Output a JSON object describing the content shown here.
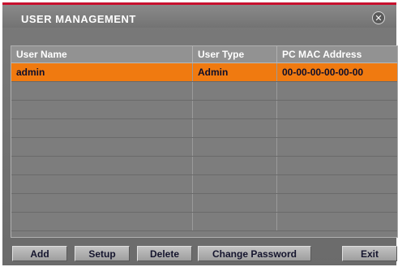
{
  "window": {
    "title": "USER MANAGEMENT",
    "close_glyph": "✕"
  },
  "table": {
    "columns": [
      "User Name",
      "User Type",
      "PC MAC Address"
    ],
    "rows": [
      [
        "admin",
        "Admin",
        "00-00-00-00-00-00"
      ],
      [
        "",
        "",
        ""
      ],
      [
        "",
        "",
        ""
      ],
      [
        "",
        "",
        ""
      ],
      [
        "",
        "",
        ""
      ],
      [
        "",
        "",
        ""
      ],
      [
        "",
        "",
        ""
      ],
      [
        "",
        "",
        ""
      ],
      [
        "",
        "",
        ""
      ]
    ],
    "selected_row": 0
  },
  "buttons": {
    "add": "Add",
    "setup": "Setup",
    "delete": "Delete",
    "change_password": "Change Password",
    "exit": "Exit"
  },
  "colors": {
    "accent_red": "#c8102e",
    "selection_orange": "#f07a10",
    "panel_gray": "#7d7d7d"
  }
}
